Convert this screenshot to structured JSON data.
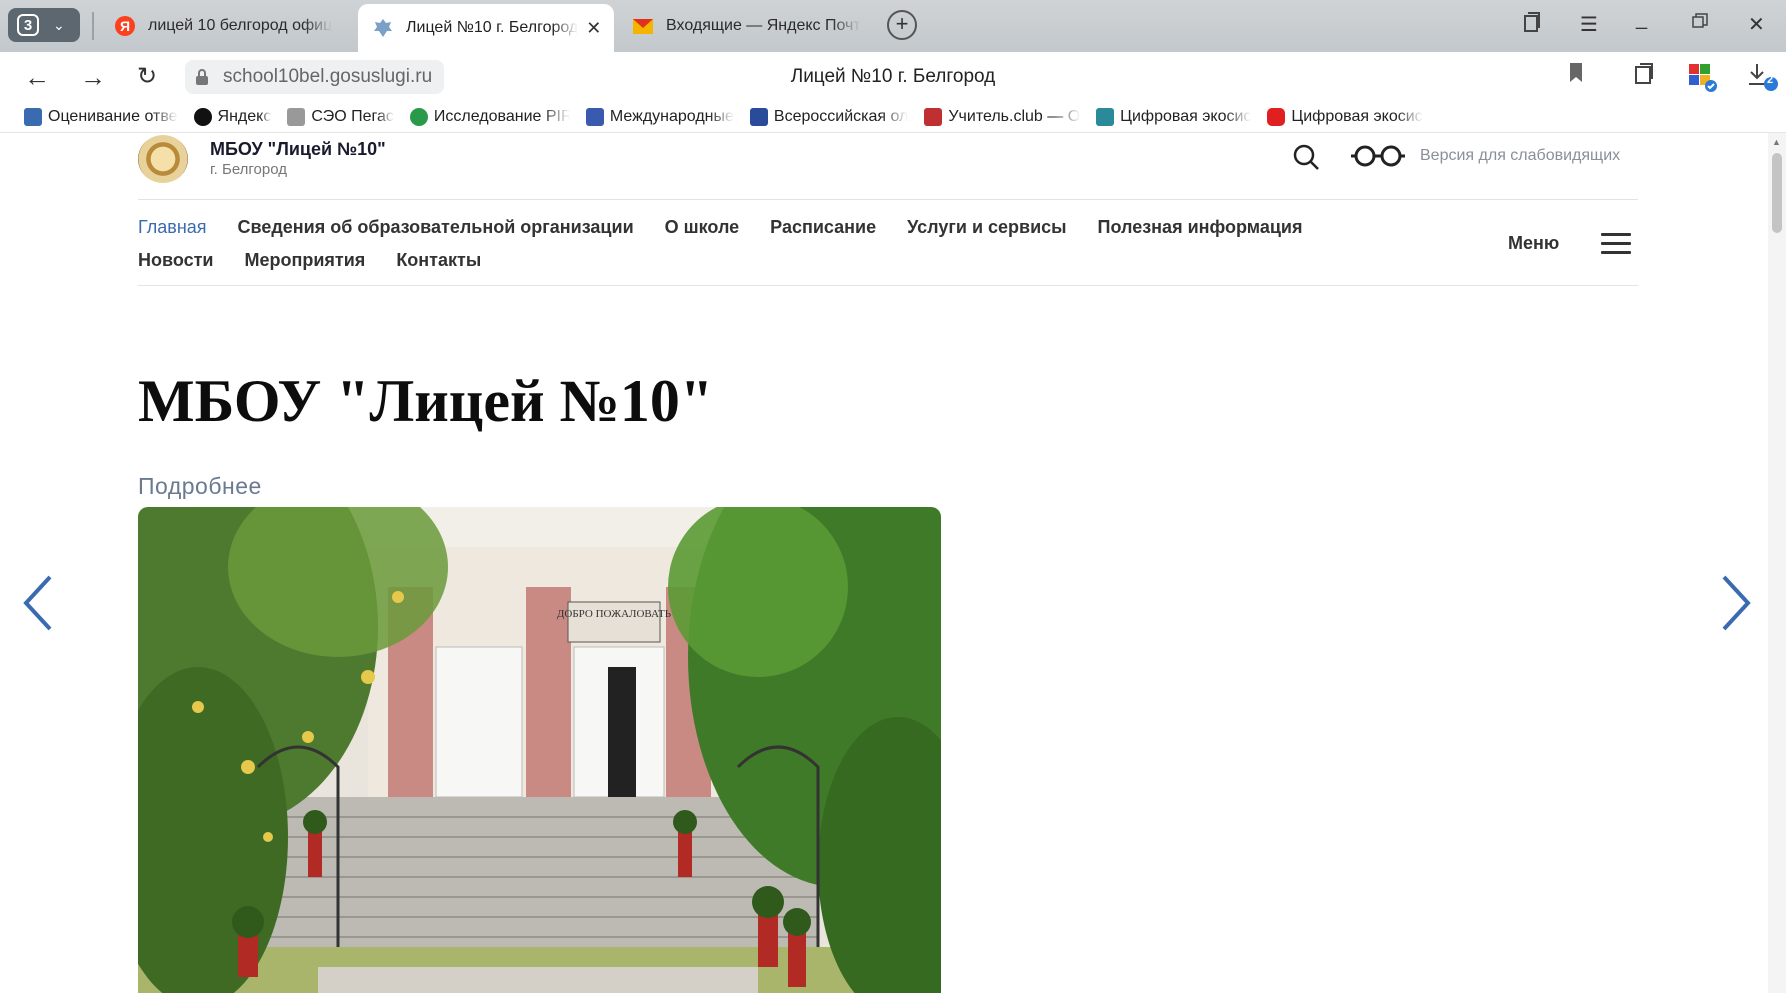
{
  "browser": {
    "tab_count": "3",
    "tabs": [
      {
        "title": "лицей 10 белгород офиц",
        "active": false
      },
      {
        "title": "Лицей №10 г. Белгород",
        "active": true
      },
      {
        "title": "Входящие — Яндекс Почт",
        "active": false
      }
    ],
    "url": "school10bel.gosuslugi.ru",
    "page_title": "Лицей №10 г. Белгород",
    "download_badge": "2"
  },
  "bookmarks": [
    {
      "label": "Оценивание отве",
      "color": "#3a6ab0"
    },
    {
      "label": "Яндекс",
      "color": "#111111"
    },
    {
      "label": "СЭО Пегас",
      "color": "#888888"
    },
    {
      "label": "Исследование PIR",
      "color": "#2a9a4a"
    },
    {
      "label": "Международные",
      "color": "#3a5ab0"
    },
    {
      "label": "Всероссийская ол",
      "color": "#2a4a9a"
    },
    {
      "label": "Учитель.club — О",
      "color": "#c03030"
    },
    {
      "label": "Цифровая экосис",
      "color": "#2a8a9a"
    },
    {
      "label": "Цифровая экосис",
      "color": "#e02020"
    }
  ],
  "site": {
    "org_name": "МБОУ \"Лицей №10\"",
    "org_city": "г. Белгород",
    "low_vision": "Версия для слабовидящих",
    "nav_row1": [
      "Главная",
      "Сведения об образовательной организации",
      "О школе",
      "Расписание",
      "Услуги и сервисы",
      "Полезная информация"
    ],
    "nav_row2": [
      "Новости",
      "Мероприятия",
      "Контакты"
    ],
    "menu_label": "Меню",
    "hero_title": "МБОУ \"Лицей №10\"",
    "more_link": "Подробнее",
    "sign_text": "ДОБРО ПОЖАЛОВАТЬ",
    "accent_color": "#3a6ab0"
  }
}
